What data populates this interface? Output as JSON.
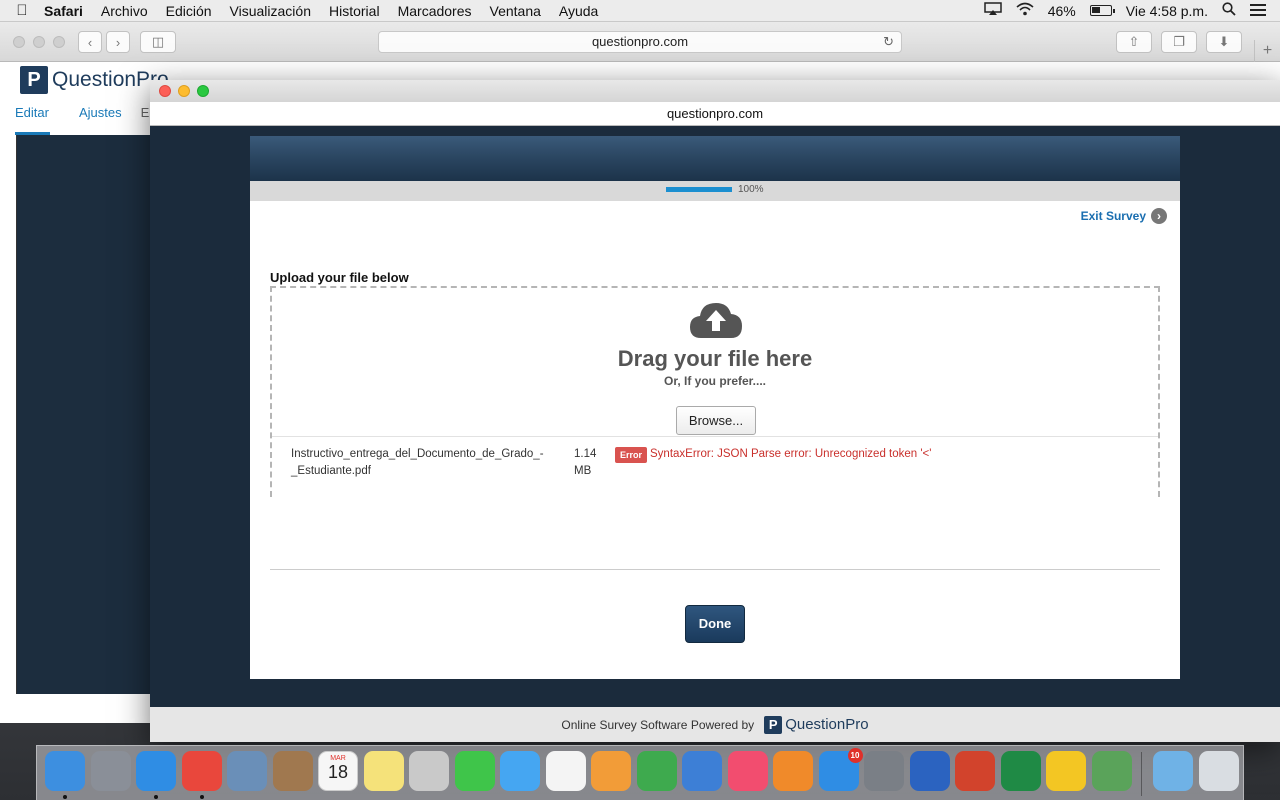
{
  "menubar": {
    "app_name": "Safari",
    "menus": [
      "Archivo",
      "Edición",
      "Visualización",
      "Historial",
      "Marcadores",
      "Ventana",
      "Ayuda"
    ],
    "battery": "46%",
    "clock": "Vie 4:58 p.m."
  },
  "browser": {
    "url": "questionpro.com",
    "logo_text": "QuestionPro",
    "logo_mark": "P",
    "subnav": {
      "edit": "Editar",
      "settings": "Ajustes",
      "more": "E"
    }
  },
  "popup": {
    "url": "questionpro.com",
    "survey": {
      "progress": {
        "percent_value": 100,
        "label": "100%"
      },
      "exit_label": "Exit Survey",
      "upload_title": "Upload your file below",
      "drag_text": "Drag your file here",
      "prefer_text": "Or, If you prefer....",
      "browse_label": "Browse...",
      "file": {
        "name": "Instructivo_entrega_del_Documento_de_Grado_-_Estudiante.pdf",
        "size": "1.14 MB",
        "error_badge": "Error",
        "error_message": "SyntaxError: JSON Parse error: Unrecognized token '<'"
      },
      "done_label": "Done"
    },
    "footer": {
      "text": "Online Survey Software Powered by",
      "logo_text": "QuestionPro",
      "logo_mark": "P"
    }
  },
  "dock": {
    "calendar": {
      "month": "MAR",
      "day": "18"
    },
    "app_store_badge": "10",
    "icons": [
      {
        "name": "finder-icon",
        "color": "#3d8fe0"
      },
      {
        "name": "launchpad-icon",
        "color": "#8a8f98"
      },
      {
        "name": "safari-icon",
        "color": "#2f8de4"
      },
      {
        "name": "chrome-icon",
        "color": "#e9473c"
      },
      {
        "name": "preview-icon",
        "color": "#6a8fb8"
      },
      {
        "name": "contacts-icon",
        "color": "#a0784f"
      },
      {
        "name": "calendar-icon",
        "color": "#f6f6f6"
      },
      {
        "name": "notes-icon",
        "color": "#f5e27a"
      },
      {
        "name": "photo-booth-icon",
        "color": "#c9c9c9"
      },
      {
        "name": "facetime-icon",
        "color": "#3fc54a"
      },
      {
        "name": "messages-icon",
        "color": "#45a6f2"
      },
      {
        "name": "photos-icon",
        "color": "#f4f4f4"
      },
      {
        "name": "pages-icon",
        "color": "#f29c38"
      },
      {
        "name": "numbers-icon",
        "color": "#3eaa4e"
      },
      {
        "name": "keynote-icon",
        "color": "#3d7fd6"
      },
      {
        "name": "itunes-icon",
        "color": "#f24d6f"
      },
      {
        "name": "ibooks-icon",
        "color": "#f08a2a"
      },
      {
        "name": "app-store-icon",
        "color": "#2f8de4"
      },
      {
        "name": "system-preferences-icon",
        "color": "#7a7f86"
      },
      {
        "name": "word-icon",
        "color": "#2b63c0"
      },
      {
        "name": "powerpoint-icon",
        "color": "#d2432c"
      },
      {
        "name": "excel-icon",
        "color": "#1f8a45"
      },
      {
        "name": "outlook-icon",
        "color": "#f3c623"
      },
      {
        "name": "network-icon",
        "color": "#5aa35a"
      },
      {
        "name": "downloads-icon",
        "color": "#6fb2e6"
      },
      {
        "name": "trash-icon",
        "color": "#d9dde2"
      }
    ]
  }
}
